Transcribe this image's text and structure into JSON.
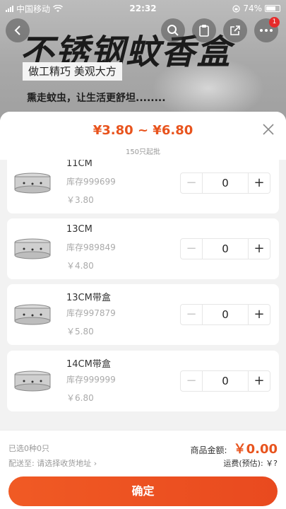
{
  "statusbar": {
    "carrier": "中国移动",
    "time": "22:32",
    "battery": "74%"
  },
  "banner": {
    "title": "不锈钢蚊香盒",
    "subtitle": "做工精巧 美观大方",
    "slogan": "熏走蚊虫，让生活更舒坦........"
  },
  "nav": {
    "badge_count": "1"
  },
  "sheet": {
    "price_range": "¥3.80 ~ ¥6.80",
    "moq": "150只起批",
    "skus": [
      {
        "name": "11CM",
        "stock": "库存999699",
        "price": "￥3.80",
        "qty": "0"
      },
      {
        "name": "13CM",
        "stock": "库存989849",
        "price": "￥4.80",
        "qty": "0"
      },
      {
        "name": "13CM带盒",
        "stock": "库存997879",
        "price": "￥5.80",
        "qty": "0"
      },
      {
        "name": "14CM带盒",
        "stock": "库存999999",
        "price": "￥6.80",
        "qty": "0"
      }
    ],
    "stepper": {
      "minus": "−",
      "plus": "+"
    },
    "footer": {
      "selected": "已选0种0只",
      "amount_label": "商品金额:",
      "amount_value": "￥0.00",
      "ship_to_label": "配送至:",
      "ship_to_value": "请选择收货地址 ›",
      "freight": "运费(预估): ￥?",
      "confirm": "确定"
    }
  },
  "colors": {
    "accent": "#e8541e",
    "confirm": "#f05a24",
    "badge": "#e52b2b"
  }
}
